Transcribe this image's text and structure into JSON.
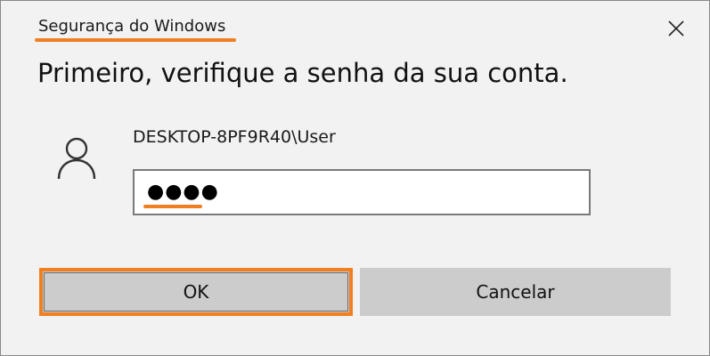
{
  "dialog": {
    "title": "Segurança do Windows",
    "close_icon": "close-icon",
    "heading": "Primeiro, verifique a senha da sua conta.",
    "user_icon": "user-icon",
    "username": "DESKTOP-8PF9R40\\User",
    "password_value": "●●●●",
    "ok_label": "OK",
    "cancel_label": "Cancelar"
  },
  "colors": {
    "accent": "#f07f22",
    "background": "#f2f2f2",
    "button": "#cccccc"
  }
}
